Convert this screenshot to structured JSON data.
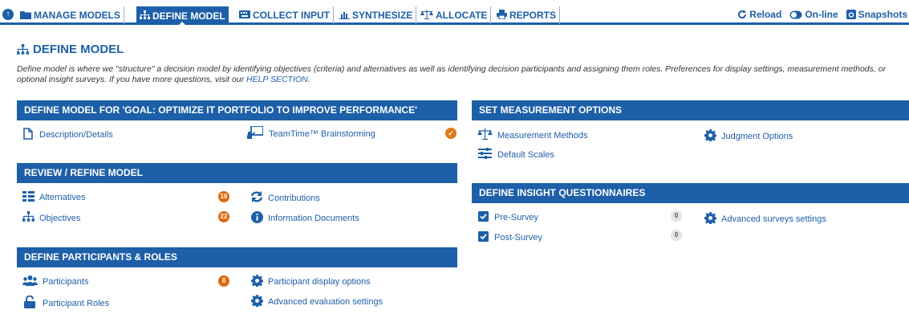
{
  "nav": {
    "tabs": [
      {
        "label": "MANAGE MODELS",
        "icon": "folder-icon"
      },
      {
        "label": "DEFINE MODEL",
        "icon": "sitemap-icon",
        "active": true
      },
      {
        "label": "COLLECT INPUT",
        "icon": "keyboard-icon"
      },
      {
        "label": "SYNTHESIZE",
        "icon": "bar-chart-icon"
      },
      {
        "label": "ALLOCATE",
        "icon": "scales-icon"
      },
      {
        "label": "REPORTS",
        "icon": "print-icon"
      }
    ],
    "tools": {
      "reload": "Reload",
      "online": "On-line",
      "snapshots": "Snapshots"
    }
  },
  "page": {
    "title": "DEFINE MODEL",
    "description": "Define model is where we \"structure\" a decision model by identifying objectives (criteria) and alternatives as well as identifying decision participants and assigning them roles. Preferences for display settings, measurement methods, or optional insight surveys. If you have more questions, visit our ",
    "help_link": "HELP SECTION",
    "description_end": "."
  },
  "panels": {
    "define_model": {
      "header": "DEFINE MODEL FOR 'GOAL: OPTIMIZE IT PORTFOLIO TO IMPROVE PERFORMANCE'",
      "description_details": "Description/Details",
      "teamtime": "TeamTime™ Brainstorming"
    },
    "review": {
      "header": "REVIEW / REFINE MODEL",
      "alternatives": "Alternatives",
      "alternatives_count": "16",
      "objectives": "Objectives",
      "objectives_count": "22",
      "contributions": "Contributions",
      "information_documents": "Information Documents"
    },
    "participants": {
      "header": "DEFINE PARTICIPANTS & ROLES",
      "participants": "Participants",
      "participants_count": "8",
      "participant_roles": "Participant Roles",
      "participant_display_options": "Participant display options",
      "advanced_evaluation_settings": "Advanced evaluation settings"
    },
    "measurement": {
      "header": "SET MEASUREMENT OPTIONS",
      "measurement_methods": "Measurement Methods",
      "default_scales": "Default Scales",
      "judgment_options": "Judgment Options"
    },
    "insight": {
      "header": "DEFINE INSIGHT QUESTIONNAIRES",
      "pre_survey": "Pre-Survey",
      "pre_survey_count": "0",
      "post_survey": "Post-Survey",
      "post_survey_count": "0",
      "advanced_surveys_settings": "Advanced surveys settings"
    }
  },
  "colors": {
    "brand": "#1d5fa8",
    "badge": "#e06a0e"
  }
}
